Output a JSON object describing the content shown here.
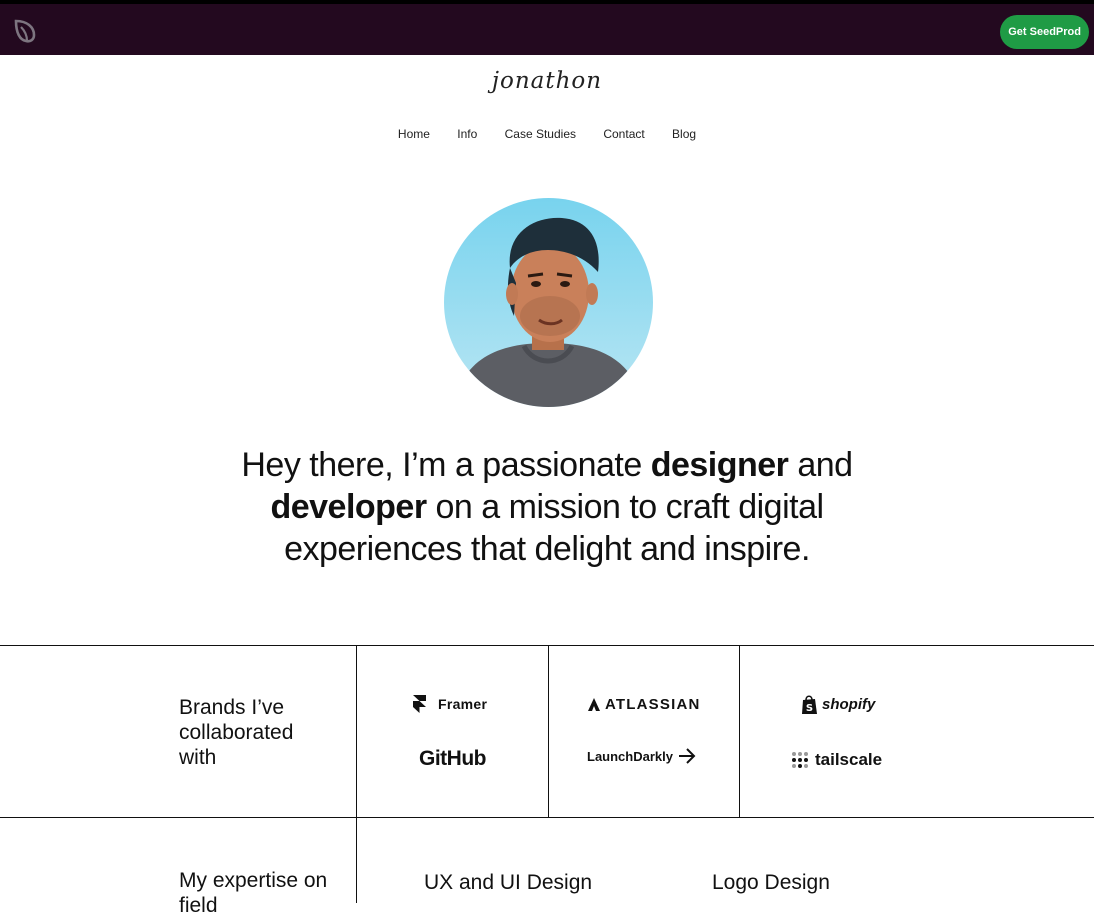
{
  "topbar": {
    "cta_label": "Get SeedProd",
    "logo_icon": "seedprod-leaf-icon",
    "background": "#23091f",
    "cta_color": "#1f9b45"
  },
  "header": {
    "brand_name": "jonathon"
  },
  "nav": {
    "items": [
      "Home",
      "Info",
      "Case Studies",
      "Contact",
      "Blog"
    ]
  },
  "hero": {
    "part1": "Hey there, I’m a passionate ",
    "bold1": "designer",
    "part2": " and",
    "bold2": "developer",
    "part3": " on a mission to craft digital",
    "part4": "experiences that delight and inspire."
  },
  "brands_section": {
    "label": "Brands I’ve collaborated with",
    "label_lines": [
      "Brands I’ve",
      "collaborated",
      "with"
    ],
    "brands": [
      "Framer",
      "GitHub",
      "ATLASSIAN",
      "LaunchDarkly",
      "shopify",
      "tailscale"
    ]
  },
  "expertise_section": {
    "label_lines": [
      "My expertise on",
      "field"
    ],
    "skills": [
      "UX and UI Design",
      "Logo Design"
    ]
  }
}
